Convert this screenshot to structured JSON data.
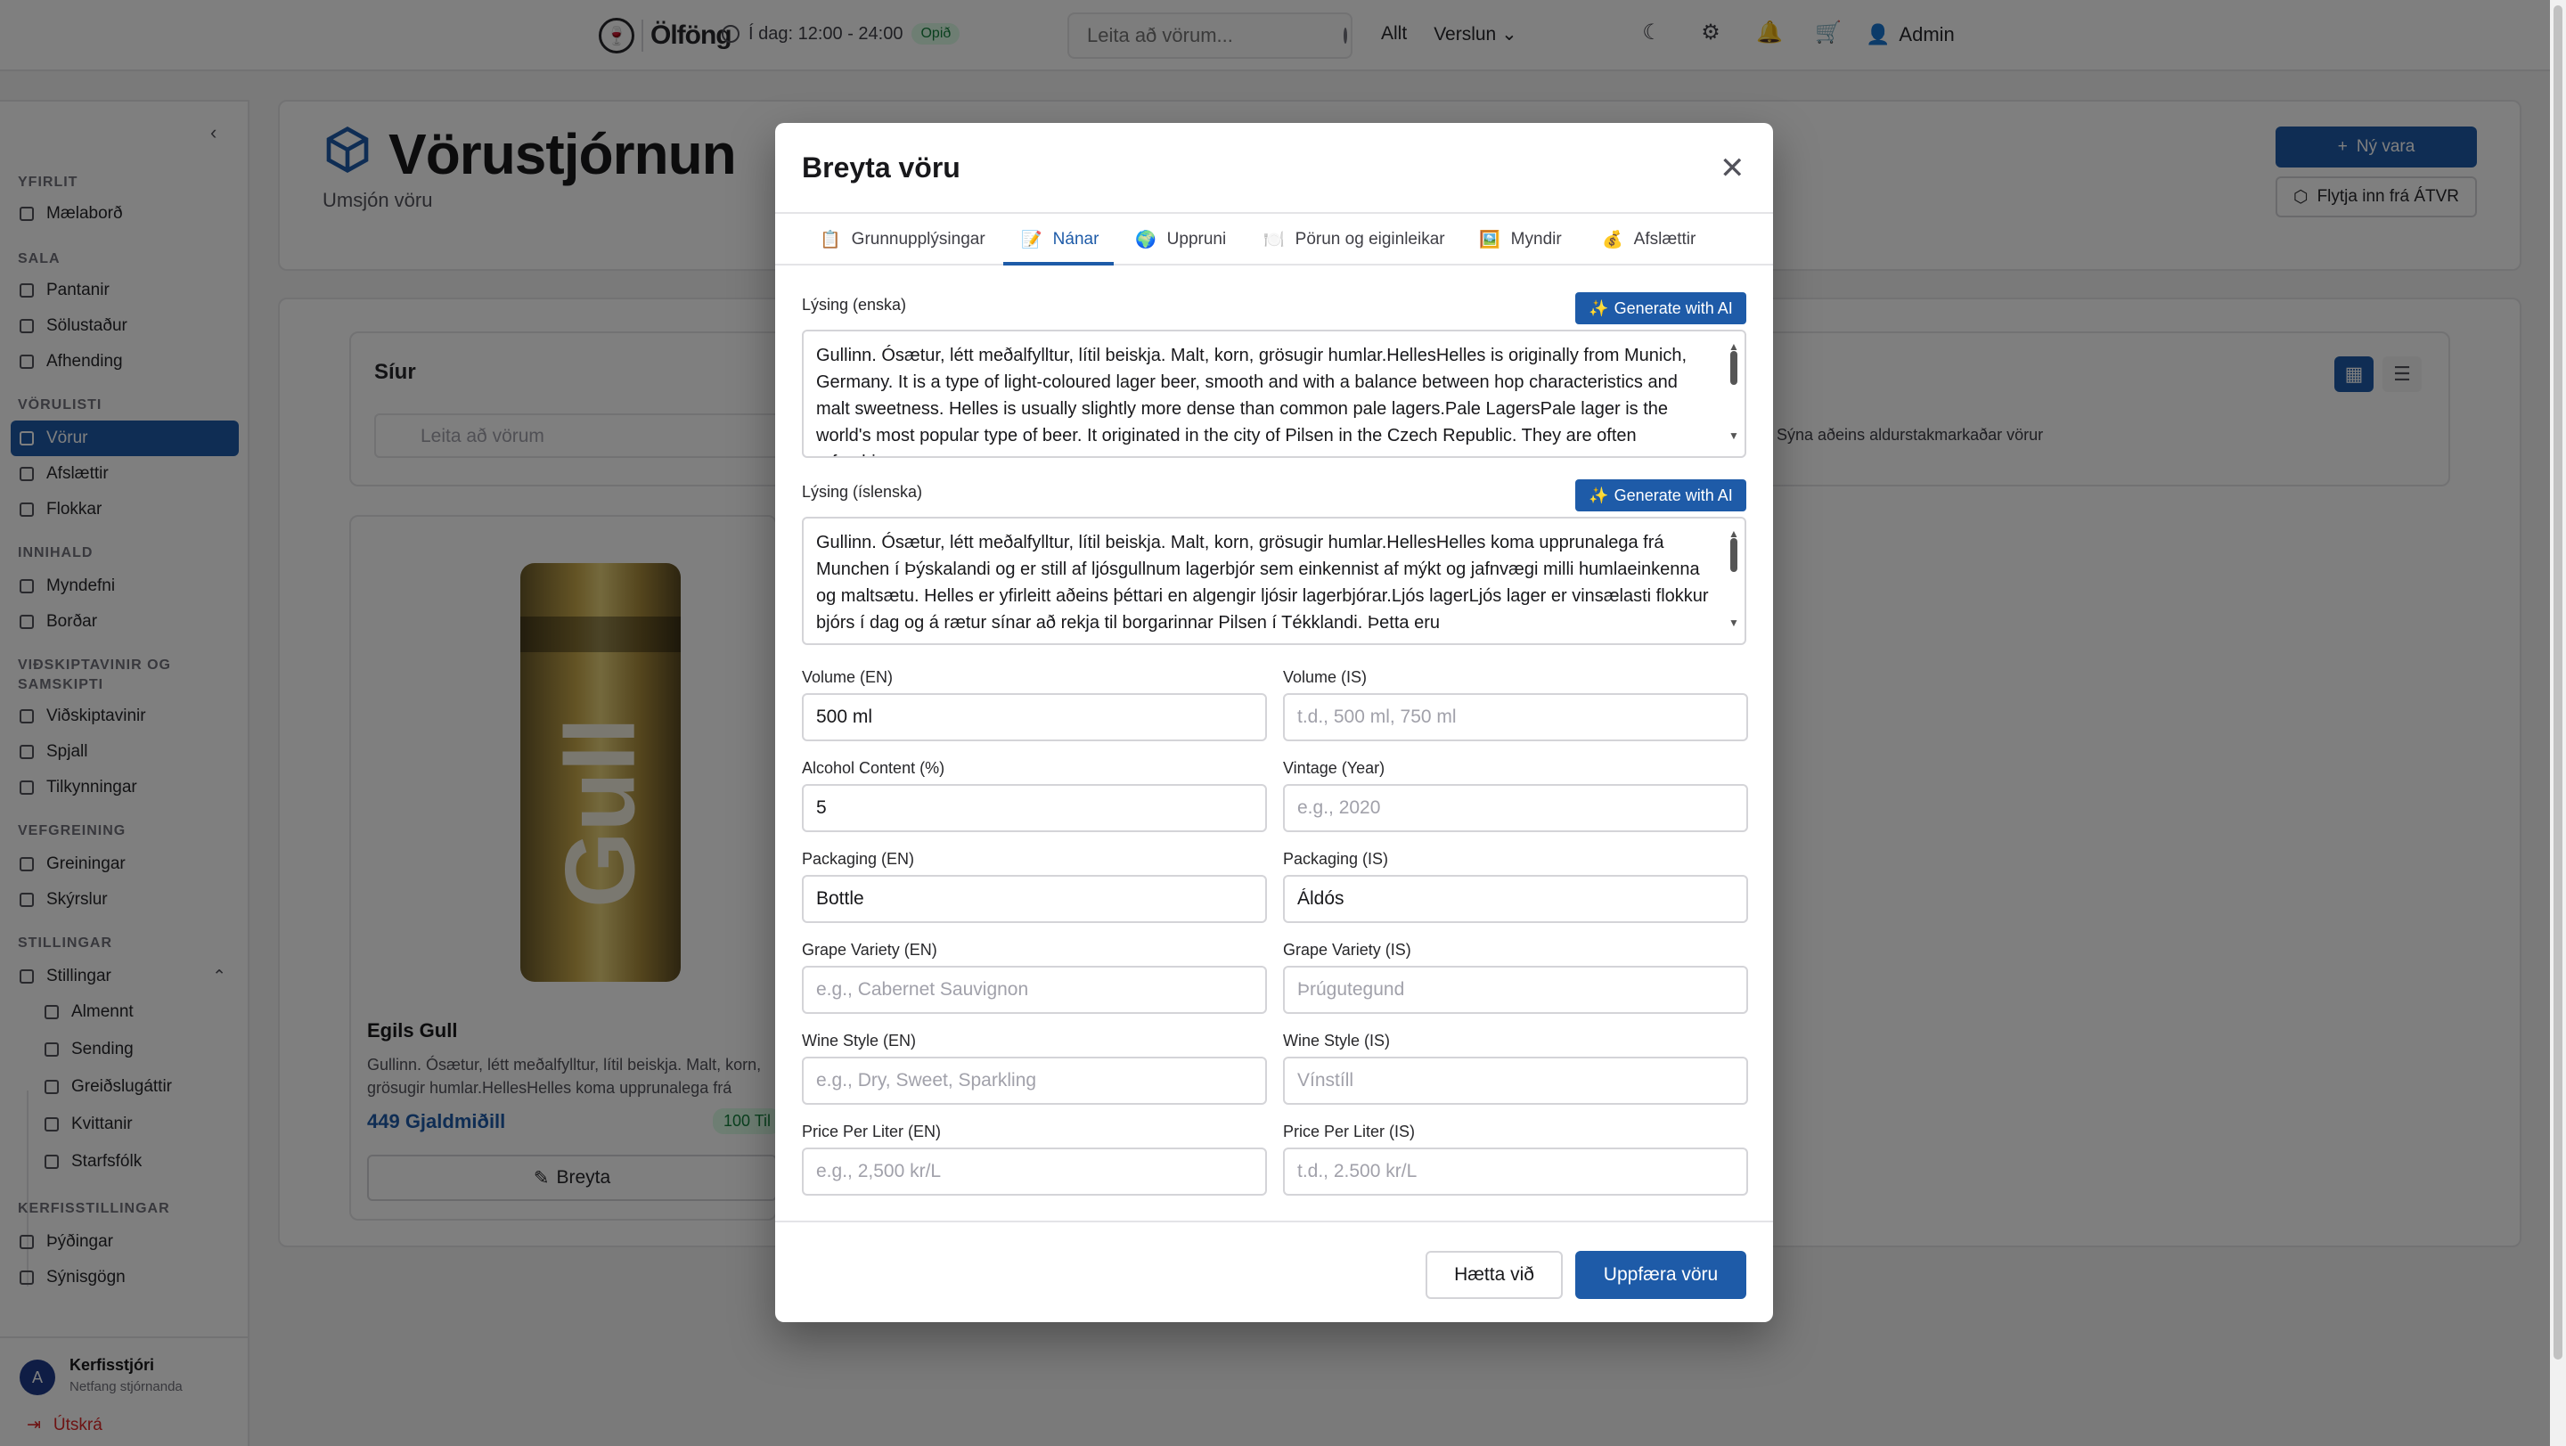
{
  "header": {
    "brand": "Ölföng",
    "hours": "Í dag: 12:00 - 24:00",
    "open_badge": "Opið",
    "search_placeholder": "Leita að vörum...",
    "nav": [
      "Allt",
      "Verslun"
    ],
    "user": "Admin"
  },
  "sidebar": {
    "sections": {
      "overview": "YFIRLIT",
      "sales": "SALA",
      "catalog": "VÖRULISTI",
      "content": "INNIHALD",
      "customers": "VIÐSKIPTAVINIR OG SAMSKIPTI",
      "analytics": "VEFGREINING",
      "settings": "STILLINGAR",
      "system": "KERFISSTILLINGAR"
    },
    "items": {
      "dashboard": "Mælaborð",
      "orders": "Pantanir",
      "pos": "Sölustaður",
      "delivery": "Afhending",
      "products": "Vörur",
      "discounts": "Afslættir",
      "categories": "Flokkar",
      "images": "Myndefni",
      "tables": "Borðar",
      "customers": "Viðskiptavinir",
      "chat": "Spjall",
      "notifications": "Tilkynningar",
      "analytics": "Greiningar",
      "reports": "Skýrslur",
      "settings": "Stillingar",
      "general": "Almennt",
      "shipping": "Sending",
      "payment": "Greiðslugáttir",
      "receipts": "Kvittanir",
      "staff": "Starfsfólk",
      "translations": "Þýðingar",
      "demo": "Sýnisgögn"
    },
    "footer": {
      "avatar_letter": "A",
      "name": "Kerfisstjóri",
      "role": "Netfang stjórnanda",
      "logout": "Útskrá"
    }
  },
  "page": {
    "title": "Vörustjórnun",
    "subtitle": "Umsjón vöru",
    "new_button": "Ný vara",
    "import_button": "Flytja inn frá ÁTVR",
    "filters_title": "Síur",
    "filters_search": "Leita að vörum",
    "age_filter": "Sýna aðeins aldurstakmarkaðar vörur"
  },
  "product": {
    "name": "Egils Gull",
    "description": "Gullinn. Ósætur, létt meðalfylltur, lítil beiskja. Malt, korn, grösugir humlar.HellesHelles koma upprunalega frá Munchen",
    "price": "449 Gjaldmiðill",
    "stock": "100 Til",
    "edit": "Breyta",
    "can_text": "Gull"
  },
  "modal": {
    "title": "Breyta vöru",
    "tabs": [
      {
        "icon": "📋",
        "label": "Grunnupplýsingar"
      },
      {
        "icon": "📝",
        "label": "Nánar"
      },
      {
        "icon": "🌍",
        "label": "Uppruni"
      },
      {
        "icon": "🍽️",
        "label": "Pörun og eiginleikar"
      },
      {
        "icon": "🖼️",
        "label": "Myndir"
      },
      {
        "icon": "💰",
        "label": "Afslættir"
      }
    ],
    "generate_label": "Generate with AI",
    "desc_en_label": "Lýsing (enska)",
    "desc_en": "Gullinn. Ósætur, létt meðalfylltur, lítil beiskja. Malt, korn, grösugir humlar.HellesHelles is originally from Munich, Germany. It is a type of light-coloured lager beer, smooth and with a balance between hop characteristics and malt sweetness. Helles is usually slightly more dense than common pale lagers.Pale LagersPale lager is the world's most popular type of beer. It originated in the city of Pilsen in the Czech Republic. They are often refreshing",
    "desc_is_label": "Lýsing (íslenska)",
    "desc_is": "Gullinn. Ósætur, létt meðalfylltur, lítil beiskja. Malt, korn, grösugir humlar.HellesHelles koma upprunalega frá Munchen í Þýskalandi og er still af ljósgullnum lagerbjór sem einkennist af mýkt og jafnvægi milli humlaeinkenna og maltsætu. Helles er yfirleitt aðeins þéttari en algengir ljósir lagerbjórar.Ljós lagerLjós lager er vinsælasti flokkur bjórs í dag og á rætur sínar að rekja til borgarinnar Pilsen í Tékklandi. Þetta eru",
    "fields": {
      "volume_en": {
        "label": "Volume (EN)",
        "value": "500 ml",
        "placeholder": ""
      },
      "volume_is": {
        "label": "Volume (IS)",
        "value": "",
        "placeholder": "t.d., 500 ml, 750 ml"
      },
      "alcohol": {
        "label": "Alcohol Content (%)",
        "value": "5",
        "placeholder": ""
      },
      "vintage": {
        "label": "Vintage (Year)",
        "value": "",
        "placeholder": "e.g., 2020"
      },
      "packaging_en": {
        "label": "Packaging (EN)",
        "value": "Bottle",
        "placeholder": ""
      },
      "packaging_is": {
        "label": "Packaging (IS)",
        "value": "Áldós",
        "placeholder": ""
      },
      "grape_en": {
        "label": "Grape Variety (EN)",
        "value": "",
        "placeholder": "e.g., Cabernet Sauvignon"
      },
      "grape_is": {
        "label": "Grape Variety (IS)",
        "value": "",
        "placeholder": "Þrúgutegund"
      },
      "wine_en": {
        "label": "Wine Style (EN)",
        "value": "",
        "placeholder": "e.g., Dry, Sweet, Sparkling"
      },
      "wine_is": {
        "label": "Wine Style (IS)",
        "value": "",
        "placeholder": "Vínstíll"
      },
      "ppl_en": {
        "label": "Price Per Liter (EN)",
        "value": "",
        "placeholder": "e.g., 2,500 kr/L"
      },
      "ppl_is": {
        "label": "Price Per Liter (IS)",
        "value": "",
        "placeholder": "t.d., 2.500 kr/L"
      }
    },
    "cancel": "Hætta við",
    "submit": "Uppfæra vöru"
  },
  "colors": {
    "accent": "#1e5ba8",
    "success": "#15803d",
    "danger": "#dc2626"
  }
}
